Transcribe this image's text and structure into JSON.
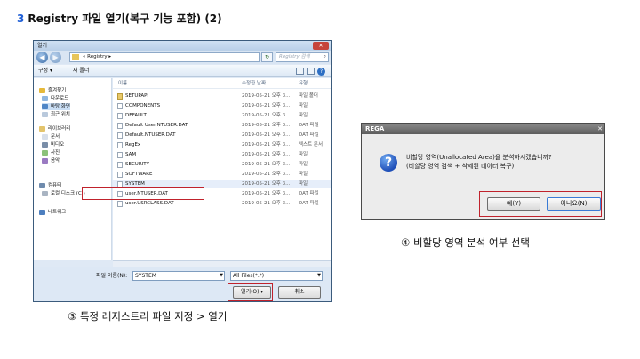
{
  "slide": {
    "number": "3",
    "title": "Registry 파일 열기(복구 기능 포함) (2)",
    "caption_open": "③ 특정 레지스트리 파일 지정 > 열기",
    "caption_select": "④ 비할당 영역 분석 여부 선택"
  },
  "open_dialog": {
    "window_title": "열기",
    "address_path": "« Registry ▸",
    "search_placeholder": "Registry 검색",
    "toolbar": {
      "organize": "구성 ▾",
      "new_folder": "새 폴더"
    },
    "nav_items": [
      {
        "label": "즐겨찾기",
        "icon": "star-icon"
      },
      {
        "label": "다운로드",
        "icon": "download-icon"
      },
      {
        "label": "바탕 화면",
        "icon": "desktop-icon"
      },
      {
        "label": "최근 위치",
        "icon": "recent-icon"
      },
      {
        "label": "라이브러리",
        "icon": "library-icon"
      },
      {
        "label": "문서",
        "icon": "document-icon"
      },
      {
        "label": "비디오",
        "icon": "video-icon"
      },
      {
        "label": "사진",
        "icon": "picture-icon"
      },
      {
        "label": "음악",
        "icon": "music-icon"
      },
      {
        "label": "컴퓨터",
        "icon": "computer-icon"
      },
      {
        "label": "로컬 디스크 (C:)",
        "icon": "disk-icon"
      },
      {
        "label": "네트워크",
        "icon": "network-icon"
      }
    ],
    "columns": {
      "name": "이름",
      "date": "수정한 날짜",
      "type": "유형"
    },
    "files": [
      {
        "name": "SETUPAPI",
        "date": "2019-05-21 오후 3...",
        "type": "파일 폴더",
        "icon": "folder-icon"
      },
      {
        "name": "COMPONENTS",
        "date": "2019-05-21 오후 3...",
        "type": "파일",
        "icon": "file-icon"
      },
      {
        "name": "DEFAULT",
        "date": "2019-05-21 오후 3...",
        "type": "파일",
        "icon": "file-icon"
      },
      {
        "name": "Default User.NTUSER.DAT",
        "date": "2019-05-21 오후 3...",
        "type": "DAT 파일",
        "icon": "file-icon"
      },
      {
        "name": "Default.NTUSER.DAT",
        "date": "2019-05-21 오후 3...",
        "type": "DAT 파일",
        "icon": "file-icon"
      },
      {
        "name": "RegEx",
        "date": "2019-05-21 오후 3...",
        "type": "텍스트 문서",
        "icon": "file-icon"
      },
      {
        "name": "SAM",
        "date": "2019-05-21 오후 3...",
        "type": "파일",
        "icon": "file-icon"
      },
      {
        "name": "SECURITY",
        "date": "2019-05-21 오후 3...",
        "type": "파일",
        "icon": "file-icon"
      },
      {
        "name": "SOFTWARE",
        "date": "2019-05-21 오후 3...",
        "type": "파일",
        "icon": "file-icon"
      },
      {
        "name": "SYSTEM",
        "date": "2019-05-21 오후 3...",
        "type": "파일",
        "icon": "file-icon"
      },
      {
        "name": "user.NTUSER.DAT",
        "date": "2019-05-21 오후 3...",
        "type": "DAT 파일",
        "icon": "file-icon"
      },
      {
        "name": "user.USRCLASS.DAT",
        "date": "2019-05-21 오후 3...",
        "type": "DAT 파일",
        "icon": "file-icon"
      }
    ],
    "filename_label": "파일 이름(N):",
    "filename_value": "SYSTEM",
    "filetype_value": "All Files(*.*)",
    "open_button": "열기(O)",
    "cancel_button": "취소"
  },
  "message_box": {
    "title": "REGA",
    "line1": "비할당 영역(Unallocated Area)을 분석하시겠습니까?",
    "line2": "(비할당 영역 검색 + 삭제된 데이터 복구)",
    "yes_button": "예(Y)",
    "no_button": "아니요(N)"
  },
  "colors": {
    "highlight": "#c0222c",
    "slide_number": "#1f5fd6"
  }
}
